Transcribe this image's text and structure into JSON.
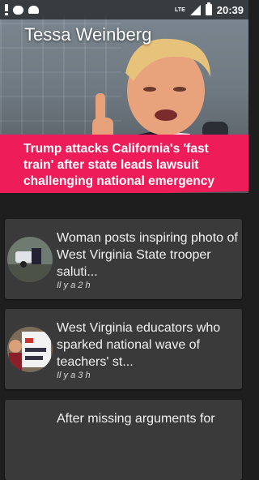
{
  "status_bar": {
    "time": "20:39",
    "network": "LTE",
    "left_icons": [
      "alert-icon",
      "message-icon",
      "android-icon"
    ],
    "right_icons": [
      "signal-icon",
      "battery-icon"
    ]
  },
  "hero": {
    "author": "Tessa Weinberg",
    "headline": "Trump attacks California's 'fast train' after state leads lawsuit challenging national emergency",
    "banner_color": "#ee1d5a"
  },
  "articles": [
    {
      "title": "Woman posts inspiring photo of West Virginia State trooper saluti...",
      "time": "Il y a 2 h"
    },
    {
      "title": "West Virginia educators who sparked national wave of teachers' st...",
      "time": "Il y a 3 h"
    },
    {
      "title": "After missing arguments for",
      "time": ""
    }
  ]
}
